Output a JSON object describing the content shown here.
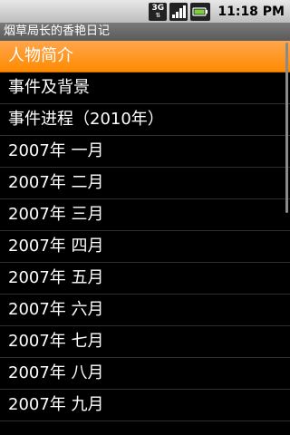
{
  "status_bar": {
    "network_type": "3G",
    "time": "11:18 PM",
    "icons": [
      "3g-icon",
      "signal-icon",
      "battery-icon"
    ]
  },
  "app": {
    "title": "烟草局长的香艳日记"
  },
  "menu": {
    "items": [
      {
        "label": "人物简介",
        "selected": true
      },
      {
        "label": "事件及背景"
      },
      {
        "label": "事件进程（2010年）"
      },
      {
        "label": "2007年 一月"
      },
      {
        "label": "2007年 二月"
      },
      {
        "label": "2007年 三月"
      },
      {
        "label": "2007年 四月"
      },
      {
        "label": "2007年 五月"
      },
      {
        "label": "2007年 六月"
      },
      {
        "label": "2007年 七月"
      },
      {
        "label": "2007年 八月"
      },
      {
        "label": "2007年 九月"
      }
    ]
  },
  "colors": {
    "selected": "#ff8a00",
    "background": "#000000"
  }
}
